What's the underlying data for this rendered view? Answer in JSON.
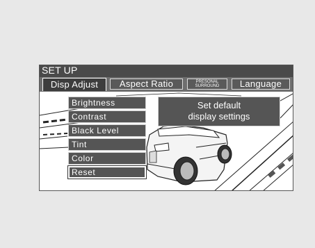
{
  "title": "SET UP",
  "tabs": [
    {
      "label": "Disp Adjust",
      "active": true
    },
    {
      "label": "Aspect Ratio",
      "active": false
    },
    {
      "label_line1": "PRESONAL",
      "label_line2": "SURROUND",
      "active": false
    },
    {
      "label": "Language",
      "active": false
    }
  ],
  "menu": {
    "items": [
      {
        "label": "Brightness"
      },
      {
        "label": "Contrast"
      },
      {
        "label": "Black Level"
      },
      {
        "label": "Tint"
      },
      {
        "label": "Color"
      },
      {
        "label": "Reset",
        "selected": true
      }
    ]
  },
  "info": {
    "line1": "Set default",
    "line2": "display settings"
  },
  "colors": {
    "page_background": "#e8e8e8",
    "title_bar": "#4a4a4a",
    "tab_row": "#6e6e6e",
    "menu_item": "#555555",
    "text": "#ffffff"
  }
}
